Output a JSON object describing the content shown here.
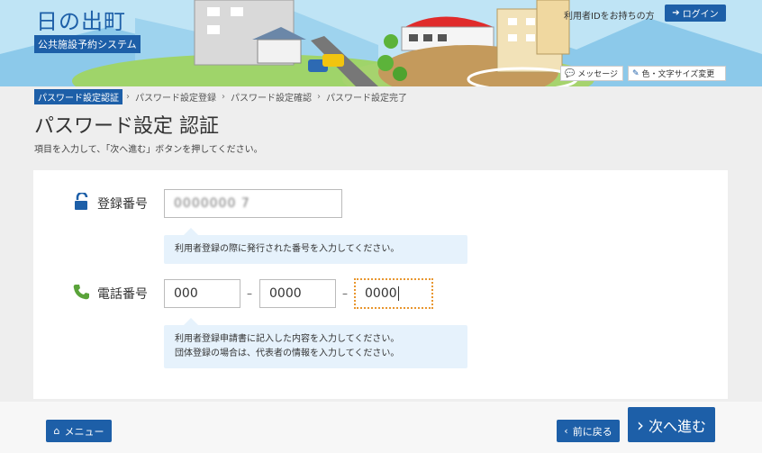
{
  "header": {
    "site_title": "日の出町",
    "site_subtitle": "公共施設予約システム",
    "login_note": "利用者IDをお持ちの方",
    "login_button": "ログイン",
    "message_link": "メッセージ",
    "color_text_link": "色・文字サイズ変更"
  },
  "breadcrumb": [
    {
      "label": "パスワード設定認証",
      "active": true
    },
    {
      "label": "パスワード設定登録",
      "active": false
    },
    {
      "label": "パスワード設定確認",
      "active": false
    },
    {
      "label": "パスワード設定完了",
      "active": false
    }
  ],
  "page": {
    "title": "パスワード設定 認証",
    "instruction": "項目を入力して、「次へ進む」ボタンを押してください。"
  },
  "form": {
    "registration": {
      "label": "登録番号",
      "value": "0000000  7",
      "hint": "利用者登録の際に発行された番号を入力してください。"
    },
    "phone": {
      "label": "電話番号",
      "part1": "000",
      "part2": "0000",
      "part3": "0000",
      "separator": "–",
      "hint_line1": "利用者登録申請書に記入した内容を入力してください。",
      "hint_line2": "団体登録の場合は、代表者の情報を入力してください。"
    }
  },
  "footer": {
    "menu_button": "メニュー",
    "back_button": "前に戻る",
    "next_button": "次へ進む"
  },
  "colors": {
    "accent": "#1d5fa8",
    "hint_bg": "#e6f2fc",
    "focus": "#e8962e"
  }
}
